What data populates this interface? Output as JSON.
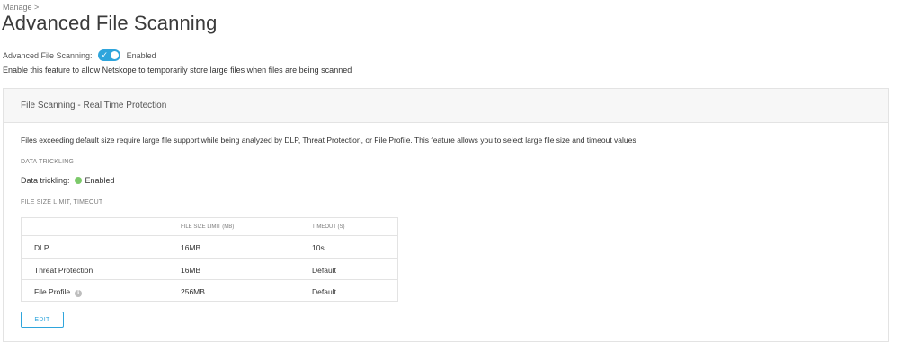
{
  "breadcrumb": "Manage >",
  "page_title": "Advanced File Scanning",
  "advanced_scanning": {
    "label": "Advanced File Scanning:",
    "toggle_icon": "check-icon",
    "status": "Enabled",
    "description": "Enable this feature to allow Netskope to temporarily store large files when files are being scanned"
  },
  "card": {
    "title": "File Scanning - Real Time Protection",
    "description": "Files exceeding default size require large file support while being analyzed by DLP, Threat Protection, or File Profile. This feature allows you to select large file size and timeout values",
    "data_trickling_heading": "DATA TRICKLING",
    "data_trickling_label": "Data trickling:",
    "data_trickling_status": "Enabled",
    "status_color": "#7cc96a",
    "file_size_heading": "FILE SIZE LIMIT, TIMEOUT",
    "table": {
      "headers": [
        "",
        "FILE SIZE LIMIT (MB)",
        "TIMEOUT (S)"
      ],
      "rows": [
        {
          "name": "DLP",
          "size": "16MB",
          "timeout": "10s"
        },
        {
          "name": "Threat Protection",
          "size": "16MB",
          "timeout": "Default"
        },
        {
          "name": "File Profile",
          "size": "256MB",
          "timeout": "Default",
          "icon": "info-icon"
        }
      ]
    },
    "edit_label": "EDIT"
  },
  "accent_color": "#2fa5dc"
}
